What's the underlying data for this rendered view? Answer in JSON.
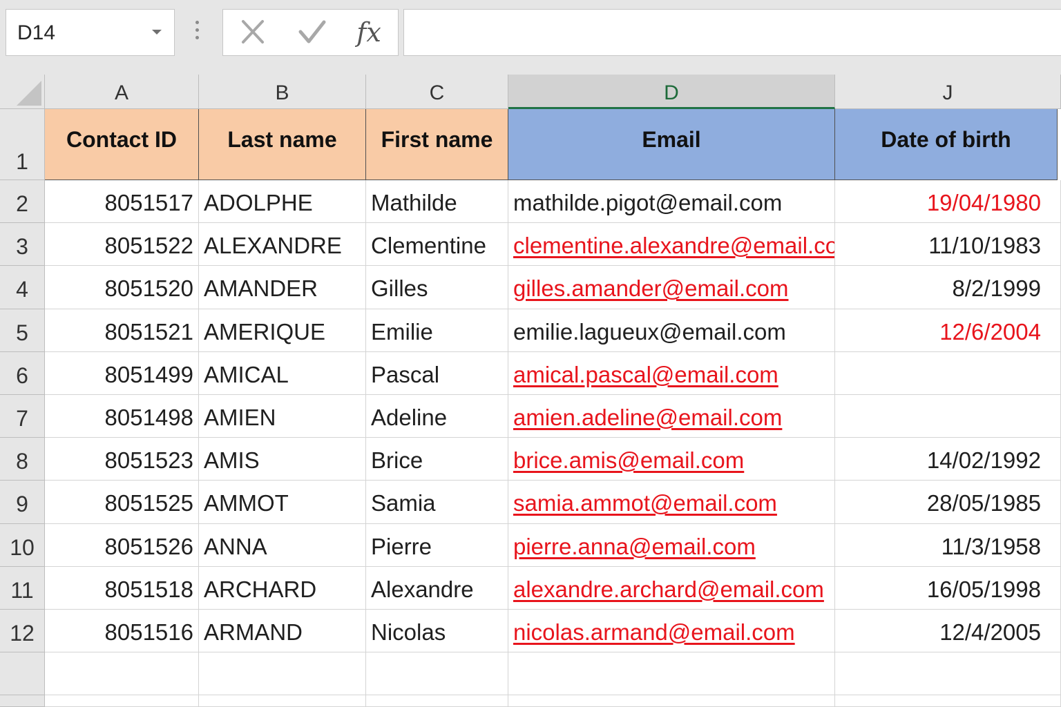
{
  "formula_bar": {
    "name_box": "D14",
    "fx_label": "fx",
    "formula_value": ""
  },
  "columns": [
    "A",
    "B",
    "C",
    "D",
    "J"
  ],
  "active_column": "D",
  "header_row": {
    "row_number": "1",
    "labels": [
      "Contact ID",
      "Last name",
      "First name",
      "Email",
      "Date of birth"
    ]
  },
  "rows": [
    {
      "num": "2",
      "id": "8051517",
      "last": "ADOLPHE",
      "first": "Mathilde",
      "email": "mathilde.pigot@email.com",
      "email_style": "plain",
      "dob": "19/04/1980",
      "dob_style": "red"
    },
    {
      "num": "3",
      "id": "8051522",
      "last": "ALEXANDRE",
      "first": "Clementine",
      "email": "clementine.alexandre@email.com",
      "email_style": "link",
      "dob": "11/10/1983",
      "dob_style": "plain"
    },
    {
      "num": "4",
      "id": "8051520",
      "last": "AMANDER",
      "first": "Gilles",
      "email": "gilles.amander@email.com",
      "email_style": "link",
      "dob": "8/2/1999",
      "dob_style": "plain"
    },
    {
      "num": "5",
      "id": "8051521",
      "last": "AMERIQUE",
      "first": "Emilie",
      "email": "emilie.lagueux@email.com",
      "email_style": "plain",
      "dob": "12/6/2004",
      "dob_style": "red"
    },
    {
      "num": "6",
      "id": "8051499",
      "last": "AMICAL",
      "first": "Pascal",
      "email": "amical.pascal@email.com",
      "email_style": "link",
      "dob": "",
      "dob_style": "plain"
    },
    {
      "num": "7",
      "id": "8051498",
      "last": "AMIEN",
      "first": "Adeline",
      "email": "amien.adeline@email.com",
      "email_style": "link",
      "dob": "",
      "dob_style": "plain"
    },
    {
      "num": "8",
      "id": "8051523",
      "last": "AMIS",
      "first": "Brice",
      "email": "brice.amis@email.com",
      "email_style": "link",
      "dob": "14/02/1992",
      "dob_style": "plain"
    },
    {
      "num": "9",
      "id": "8051525",
      "last": "AMMOT",
      "first": "Samia",
      "email": "samia.ammot@email.com",
      "email_style": "link",
      "dob": "28/05/1985",
      "dob_style": "plain"
    },
    {
      "num": "10",
      "id": "8051526",
      "last": "ANNA",
      "first": "Pierre",
      "email": "pierre.anna@email.com",
      "email_style": "link",
      "dob": "11/3/1958",
      "dob_style": "plain"
    },
    {
      "num": "11",
      "id": "8051518",
      "last": "ARCHARD",
      "first": "Alexandre",
      "email": "alexandre.archard@email.com",
      "email_style": "link",
      "dob": "16/05/1998",
      "dob_style": "plain"
    },
    {
      "num": "12",
      "id": "8051516",
      "last": "ARMAND",
      "first": "Nicolas",
      "email": "nicolas.armand@email.com",
      "email_style": "link",
      "dob": "12/4/2005",
      "dob_style": "plain"
    }
  ],
  "colors": {
    "header_peach": "#f9cba6",
    "header_blue": "#8fadde",
    "flag_red": "#e8141c",
    "active_column_green": "#217346"
  }
}
